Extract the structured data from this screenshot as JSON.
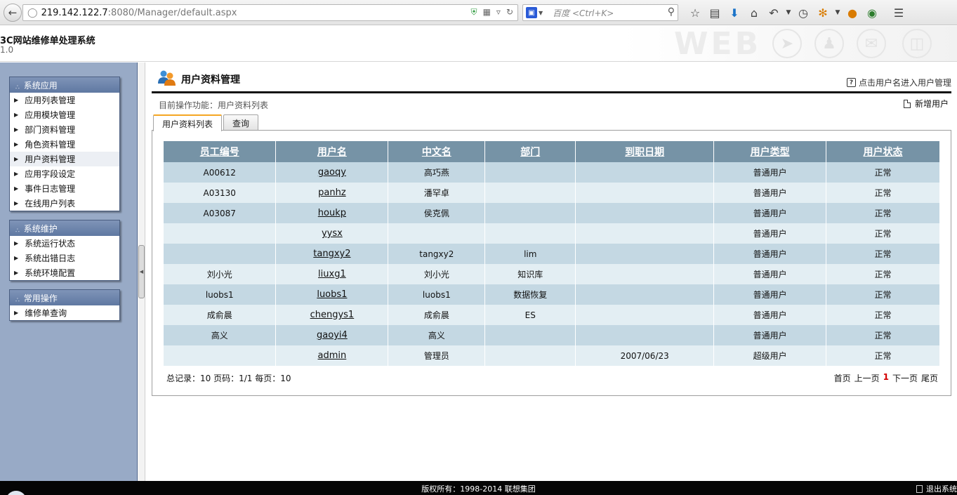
{
  "browser": {
    "url_host": "219.142.122.7",
    "url_path": ":8080/Manager/default.aspx",
    "search_placeholder": "百度 <Ctrl+K>"
  },
  "app": {
    "title": "3C网站维修单处理系统",
    "version": "1.0",
    "watermark": "WEB"
  },
  "sidebar": {
    "groups": [
      {
        "title": "系统应用",
        "items": [
          "应用列表管理",
          "应用模块管理",
          "部门资料管理",
          "角色资料管理",
          "用户资料管理",
          "应用字段设定",
          "事件日志管理",
          "在线用户列表"
        ]
      },
      {
        "title": "系统维护",
        "items": [
          "系统运行状态",
          "系统出错日志",
          "系统环境配置"
        ]
      },
      {
        "title": "常用操作",
        "items": [
          "维修单查询"
        ]
      }
    ],
    "active_item": "用户资料管理"
  },
  "page": {
    "title": "用户资料管理",
    "help_text": "点击用户名进入用户管理",
    "current_op": "目前操作功能：用户资料列表",
    "add_user": "新增用户"
  },
  "tabs": [
    {
      "label": "用户资料列表",
      "active": true
    },
    {
      "label": "查询",
      "active": false
    }
  ],
  "table": {
    "headers": [
      "员工编号",
      "用户名",
      "中文名",
      "部门",
      "到职日期",
      "用户类型",
      "用户状态"
    ],
    "rows": [
      [
        "A00612",
        "gaoqy",
        "高巧燕",
        "",
        "",
        "普通用户",
        "正常"
      ],
      [
        "A03130",
        "panhz",
        "潘罕卓",
        "",
        "",
        "普通用户",
        "正常"
      ],
      [
        "A03087",
        "houkp",
        "侯克佩",
        "",
        "",
        "普通用户",
        "正常"
      ],
      [
        "",
        "yysx",
        "",
        "",
        "",
        "普通用户",
        "正常"
      ],
      [
        "",
        "tangxy2",
        "tangxy2",
        "lim",
        "",
        "普通用户",
        "正常"
      ],
      [
        "刘小光",
        "liuxg1",
        "刘小光",
        "知识库",
        "",
        "普通用户",
        "正常"
      ],
      [
        "luobs1",
        "luobs1",
        "luobs1",
        "数据恢复",
        "",
        "普通用户",
        "正常"
      ],
      [
        "成俞晨",
        "chengys1",
        "成俞晨",
        "ES",
        "",
        "普通用户",
        "正常"
      ],
      [
        "高义",
        "gaoyi4",
        "高义",
        "",
        "",
        "普通用户",
        "正常"
      ],
      [
        "",
        "admin",
        "管理员",
        "",
        "2007/06/23",
        "超级用户",
        "正常"
      ]
    ]
  },
  "summary": "总记录：10 页码：1/1 每页：10",
  "pager": {
    "first": "首页",
    "prev": "上一页",
    "current": "1",
    "next": "下一页",
    "last": "尾页"
  },
  "footer": {
    "copyright": "版权所有：1998-2014 联想集团",
    "logout": "退出系统"
  }
}
